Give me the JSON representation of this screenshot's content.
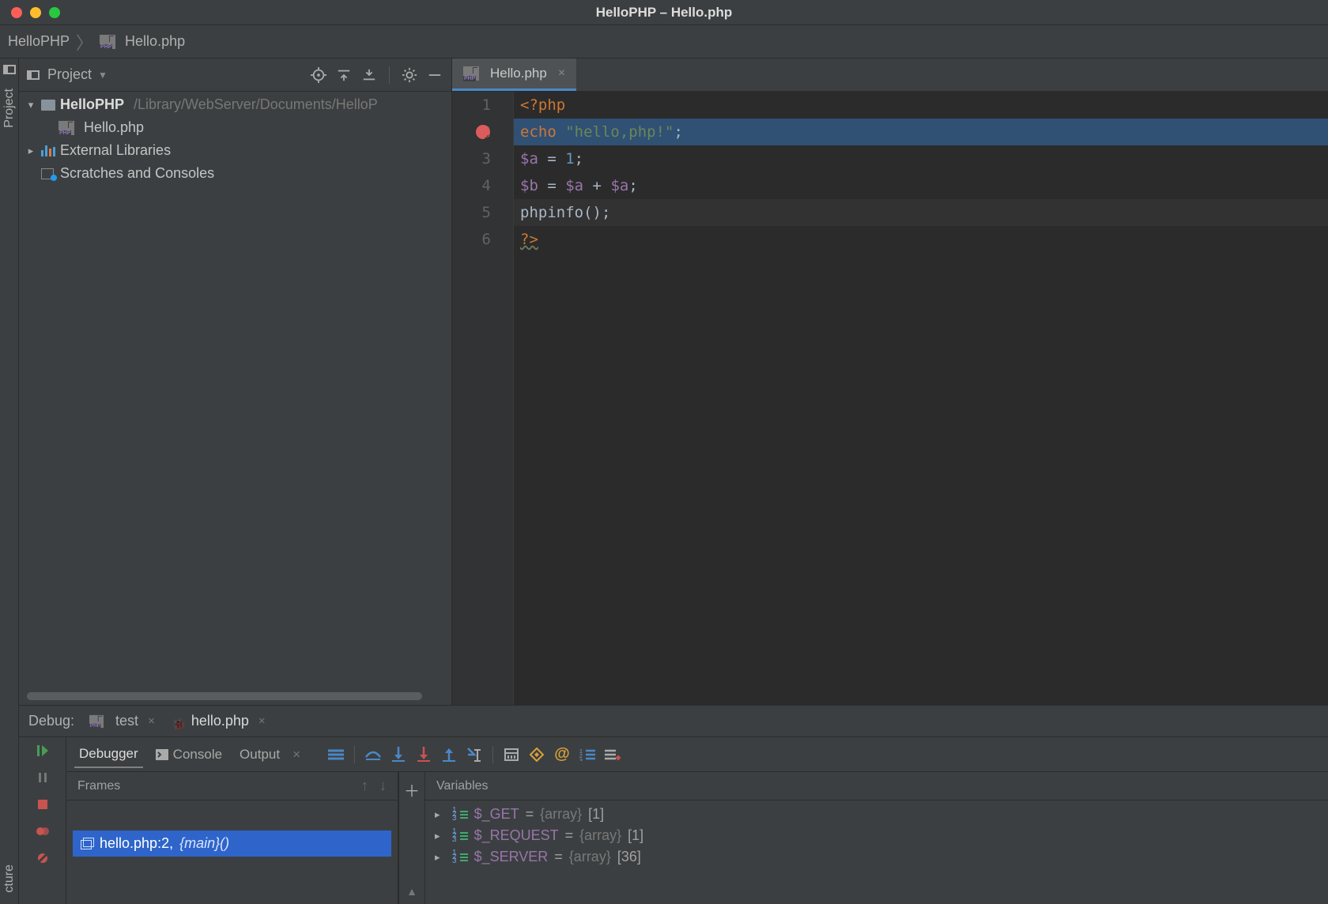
{
  "window": {
    "title": "HelloPHP – Hello.php"
  },
  "breadcrumb": {
    "project": "HelloPHP",
    "file": "Hello.php"
  },
  "left_strip": {
    "project_label": "Project",
    "structure_label": "cture"
  },
  "project_panel": {
    "title": "Project",
    "root": {
      "name": "HelloPHP",
      "path": "/Library/WebServer/Documents/HelloP"
    },
    "file": "Hello.php",
    "external_libs": "External Libraries",
    "scratches": "Scratches and Consoles"
  },
  "editor": {
    "tab": "Hello.php",
    "lines": [
      {
        "n": 1,
        "tokens": [
          [
            "tag",
            "<?php"
          ]
        ]
      },
      {
        "n": 2,
        "tokens": [
          [
            "kw",
            "echo "
          ],
          [
            "str",
            "\"hello,php!\""
          ],
          [
            "pn",
            ";"
          ]
        ],
        "exec": true
      },
      {
        "n": 3,
        "tokens": [
          [
            "var",
            "$a"
          ],
          [
            "pn",
            " = "
          ],
          [
            "num",
            "1"
          ],
          [
            "pn",
            ";"
          ]
        ]
      },
      {
        "n": 4,
        "tokens": [
          [
            "var",
            "$b"
          ],
          [
            "pn",
            " = "
          ],
          [
            "var",
            "$a"
          ],
          [
            "pn",
            " + "
          ],
          [
            "var",
            "$a"
          ],
          [
            "pn",
            ";"
          ]
        ]
      },
      {
        "n": 5,
        "tokens": [
          [
            "pn",
            "phpinfo();"
          ]
        ],
        "cursor": true
      },
      {
        "n": 6,
        "tokens": [
          [
            "tag",
            "?>"
          ]
        ],
        "squiggle": true
      }
    ]
  },
  "debug": {
    "title": "Debug:",
    "configs": [
      {
        "name": "test",
        "active": false,
        "icon": "php"
      },
      {
        "name": "hello.php",
        "active": true,
        "icon": "bug"
      }
    ],
    "subtabs": {
      "debugger": "Debugger",
      "console": "Console",
      "output": "Output"
    },
    "frames": {
      "header": "Frames",
      "selected": {
        "file": "hello.php:2",
        "func": "{main}()"
      }
    },
    "variables": {
      "header": "Variables",
      "items": [
        {
          "name": "$_GET",
          "type": "{array}",
          "count": "[1]"
        },
        {
          "name": "$_REQUEST",
          "type": "{array}",
          "count": "[1]"
        },
        {
          "name": "$_SERVER",
          "type": "{array}",
          "count": "[36]"
        }
      ]
    }
  }
}
